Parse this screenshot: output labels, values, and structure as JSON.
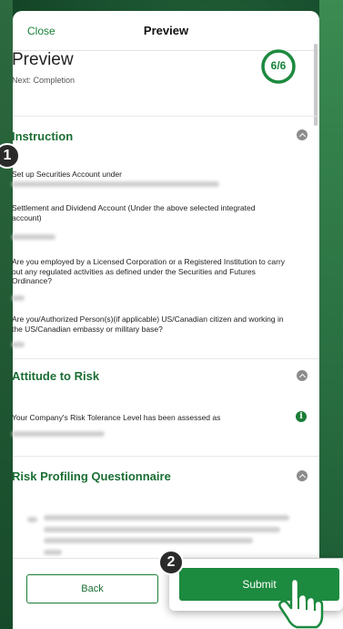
{
  "topbar": {
    "close_label": "Close",
    "title": "Preview"
  },
  "header": {
    "title": "Preview",
    "subtitle": "Next: Completion",
    "progress_text": "6/6",
    "progress_fraction": 1.0
  },
  "sections": {
    "instruction": {
      "title": "Instruction",
      "q1": "Set up Securities Account under",
      "q2": "Settlement and Dividend Account (Under the above selected integrated account)",
      "q3": "Are you employed by a Licensed Corporation or a Registered Institution to carry out any regulated activities as defined under the Securities and Futures Ordinance?",
      "q4": "Are you/Authorized Person(s)(if applicable) US/Canadian citizen and working in the US/Canadian embassy or military base?"
    },
    "attitude": {
      "title": "Attitude to Risk",
      "q1": "Your Company's Risk Tolerance Level has been assessed as"
    },
    "risk_profiling": {
      "title": "Risk Profiling Questionnaire"
    }
  },
  "footer": {
    "back_label": "Back",
    "submit_label": "Submit"
  },
  "annotations": {
    "badge1": "1",
    "badge2": "2"
  },
  "colors": {
    "brand_green": "#1c8a3f",
    "heading_green": "#1b6e34",
    "info_icon": "i"
  }
}
